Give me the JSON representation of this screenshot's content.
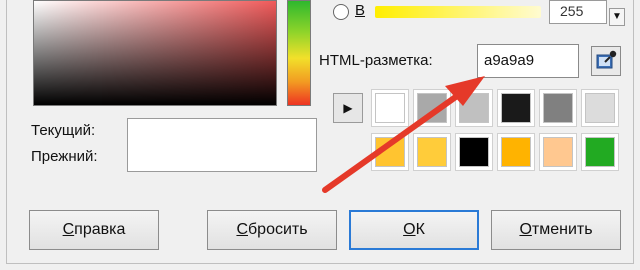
{
  "labels": {
    "radio_letter": "B",
    "html_label": "HTML-разметка:",
    "current": "Текущий:",
    "previous": "Прежний:"
  },
  "fields": {
    "blue_value": "255",
    "html_value": "a9a9a9"
  },
  "buttons": {
    "help": {
      "first": "С",
      "rest": "правка"
    },
    "reset": {
      "first": "С",
      "rest": "бросить"
    },
    "ok": {
      "first": "О",
      "rest": "К"
    },
    "cancel": {
      "first": "О",
      "rest": "тменить"
    }
  },
  "swatches": {
    "row1": [
      "#ffffff",
      "#a9a9a9",
      "#c0c0c0",
      "#1a1a1a",
      "#808080",
      "#dcdcdc"
    ],
    "row2": [
      "#ffc430",
      "#ffcc3a",
      "#000000",
      "#ffb300",
      "#ffc890",
      "#22aa22"
    ]
  },
  "colors": {
    "annotation_arrow": "#e53929",
    "default_button_border": "#2a7ad6"
  },
  "icons": {
    "play": "▶",
    "spin_down": "▼"
  }
}
